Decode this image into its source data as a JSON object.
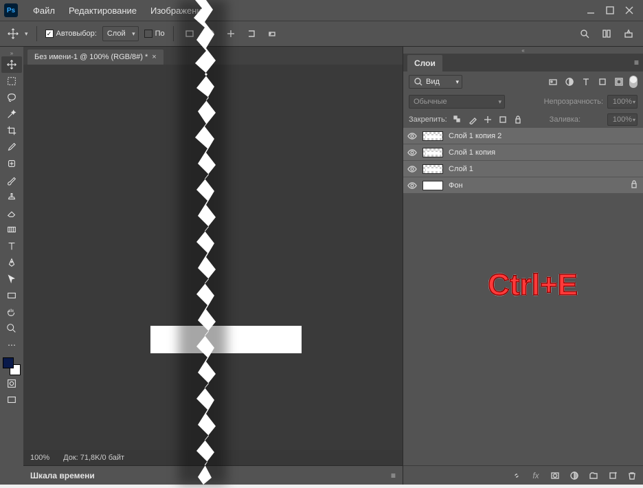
{
  "menubar": {
    "logo": "Ps",
    "items": [
      "Файл",
      "Редактирование",
      "Изображение"
    ]
  },
  "optionsbar": {
    "auto_select_label": "Автовыбор:",
    "auto_select_target": "Слой",
    "show_prefix": "По"
  },
  "document": {
    "tab_title": "Без имени-1 @ 100% (RGB/8#) *",
    "zoom": "100%",
    "doc_info": "Док: 71,8K/0 байт"
  },
  "timeline": {
    "label": "Шкала времени"
  },
  "layers_panel": {
    "title": "Слои",
    "filter_kind": "Вид",
    "blend_mode": "Обычные",
    "opacity_label": "Непрозрачность:",
    "opacity_value": "100%",
    "lock_label": "Закрепить:",
    "fill_label": "Заливка:",
    "fill_value": "100%",
    "layers": [
      {
        "name": "Слой 1 копия 2",
        "locked": false
      },
      {
        "name": "Слой 1 копия",
        "locked": false
      },
      {
        "name": "Слой 1",
        "locked": false
      },
      {
        "name": "Фон",
        "locked": true
      }
    ]
  },
  "annotation": {
    "hotkey": "Ctrl+E"
  }
}
